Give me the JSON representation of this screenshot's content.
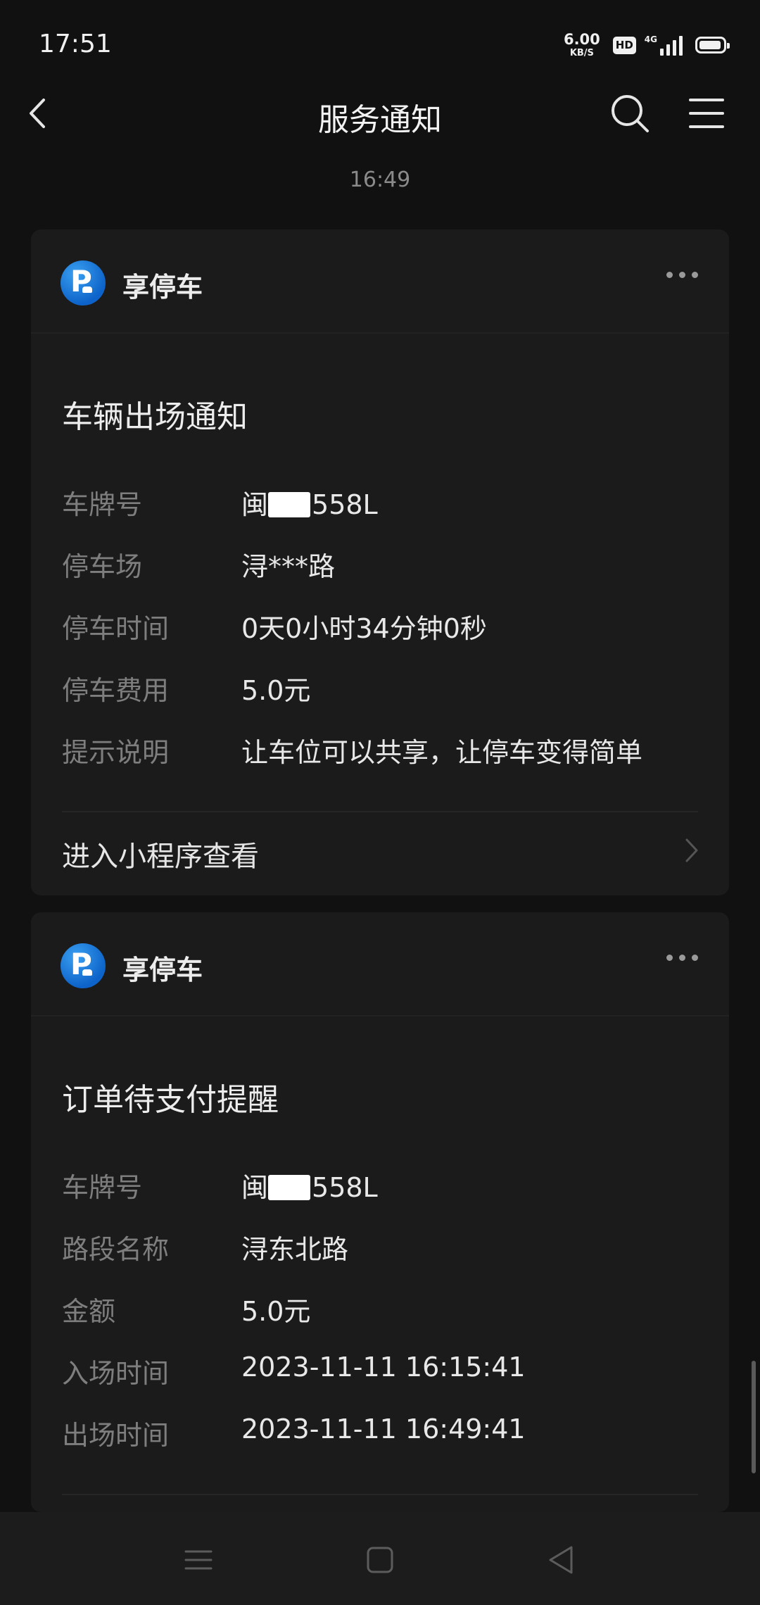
{
  "status_bar": {
    "time": "17:51",
    "net_speed_value": "6.00",
    "net_speed_unit": "KB/S",
    "hd_label": "HD",
    "network_label": "4G"
  },
  "nav": {
    "title": "服务通知"
  },
  "timestamp": "16:49",
  "cards": [
    {
      "app_name": "享停车",
      "logo_letter": "P",
      "title": "车辆出场通知",
      "fields": [
        {
          "label": "车牌号",
          "prefix": "闽",
          "value": "558L"
        },
        {
          "label": "停车场",
          "value": "浔***路"
        },
        {
          "label": "停车时间",
          "value": "0天0小时34分钟0秒"
        },
        {
          "label": "停车费用",
          "value": "5.0元"
        },
        {
          "label": "提示说明",
          "value": "让车位可以共享，让停车变得简单"
        }
      ],
      "link_label": "进入小程序查看"
    },
    {
      "app_name": "享停车",
      "logo_letter": "P",
      "title": "订单待支付提醒",
      "fields": [
        {
          "label": "车牌号",
          "prefix": "闽",
          "value": "558L"
        },
        {
          "label": "路段名称",
          "value": "浔东北路"
        },
        {
          "label": "金额",
          "value": "5.0元"
        },
        {
          "label": "入场时间",
          "value": "2023-11-11 16:15:41"
        },
        {
          "label": "出场时间",
          "value": "2023-11-11 16:49:41"
        }
      ]
    }
  ],
  "icons": {
    "back": "chevron-left-icon",
    "search": "search-icon",
    "menu": "menu-icon",
    "more": "more-horizontal-icon",
    "link_chevron": "chevron-right-icon",
    "sys_recents": "recents-icon",
    "sys_home": "home-icon",
    "sys_back": "back-triangle-icon"
  }
}
